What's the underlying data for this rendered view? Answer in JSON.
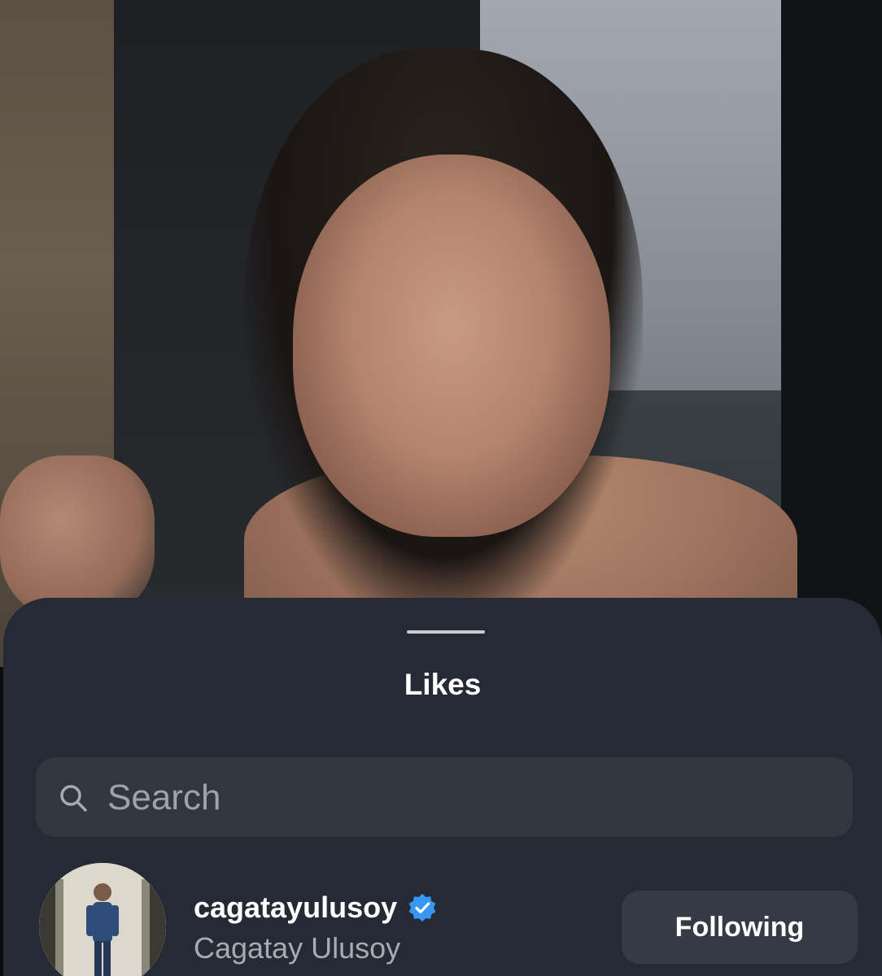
{
  "photo": {
    "description_icon": "portrait-photo"
  },
  "sheet": {
    "title": "Likes"
  },
  "search": {
    "placeholder": "Search",
    "icon": "search-icon"
  },
  "likes_list": [
    {
      "username": "cagatayulusoy",
      "full_name": "Cagatay Ulusoy",
      "verified": true,
      "button_label": "Following"
    }
  ],
  "colors": {
    "sheet_background": "#262a34",
    "search_background": "#32363f",
    "button_background": "#363a44",
    "verified_badge": "#3897f0",
    "text_primary": "#ffffff",
    "text_secondary": "#a7abb4"
  }
}
